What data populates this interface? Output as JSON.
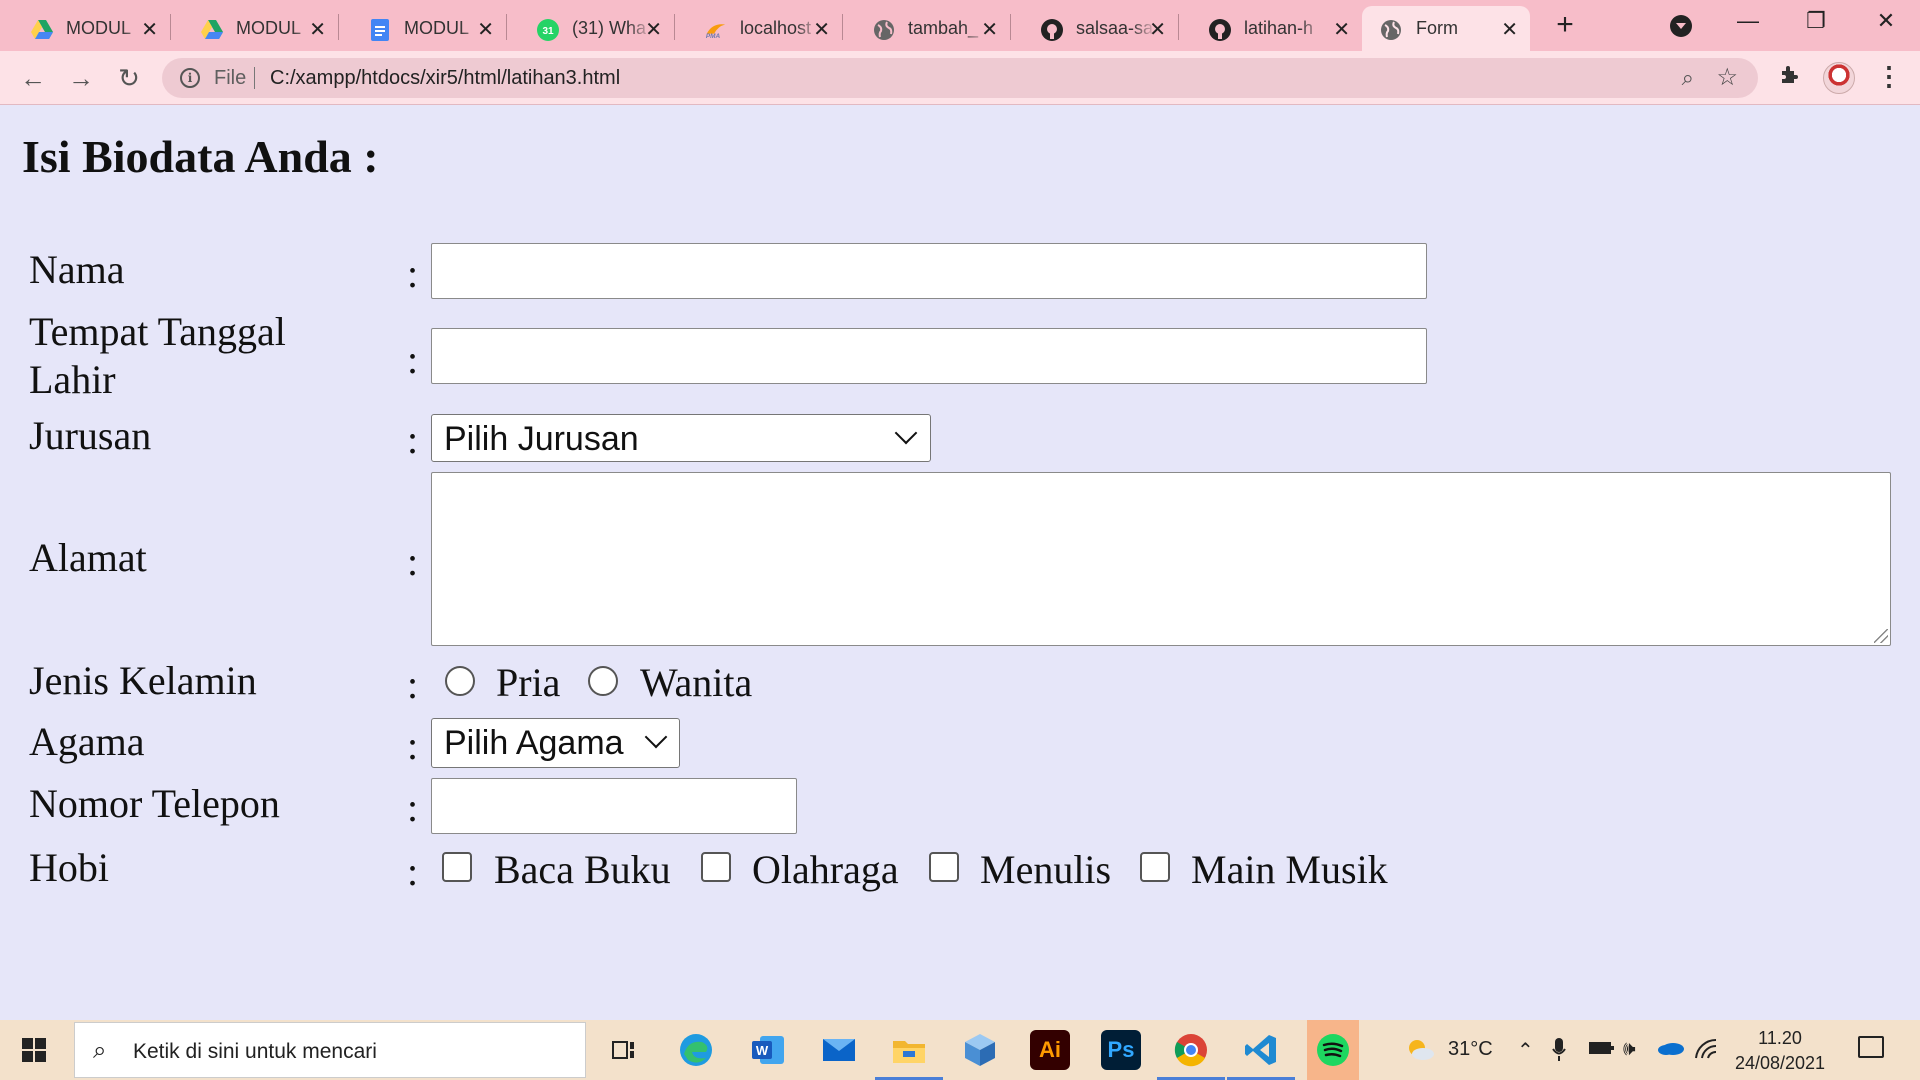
{
  "browser": {
    "tabs": [
      {
        "title": "MODUL",
        "icon": "google-drive-icon"
      },
      {
        "title": "MODUL",
        "icon": "google-drive-icon"
      },
      {
        "title": "MODUL",
        "icon": "google-docs-icon"
      },
      {
        "title": "(31) Wha",
        "icon": "whatsapp-icon"
      },
      {
        "title": "localhost",
        "icon": "phpmyadmin-icon"
      },
      {
        "title": "tambah_",
        "icon": "globe-icon"
      },
      {
        "title": "salsaa-sa",
        "icon": "github-icon"
      },
      {
        "title": "latihan-h",
        "icon": "github-icon"
      },
      {
        "title": "Form",
        "icon": "globe-icon"
      }
    ],
    "omnibox": {
      "scheme": "File",
      "url": "C:/xampp/htdocs/xir5/html/latihan3.html"
    }
  },
  "page": {
    "title": "Isi Biodata Anda :",
    "fields": {
      "nama": "Nama",
      "ttl_line1": "Tempat Tanggal",
      "ttl_line2": "Lahir",
      "jurusan": "Jurusan",
      "alamat": "Alamat",
      "jenis_kelamin": "Jenis Kelamin",
      "agama": "Agama",
      "telepon": "Nomor Telepon",
      "hobi": "Hobi"
    },
    "colon": ":",
    "jurusan_selected": "Pilih Jurusan",
    "agama_selected": "Pilih Agama",
    "gender_options": [
      "Pria",
      "Wanita"
    ],
    "hobi_options": [
      "Baca Buku",
      "Olahraga",
      "Menulis",
      "Main Musik"
    ]
  },
  "taskbar": {
    "search_placeholder": "Ketik di sini untuk mencari",
    "weather": "31°C",
    "time": "11.20",
    "date": "24/08/2021"
  }
}
